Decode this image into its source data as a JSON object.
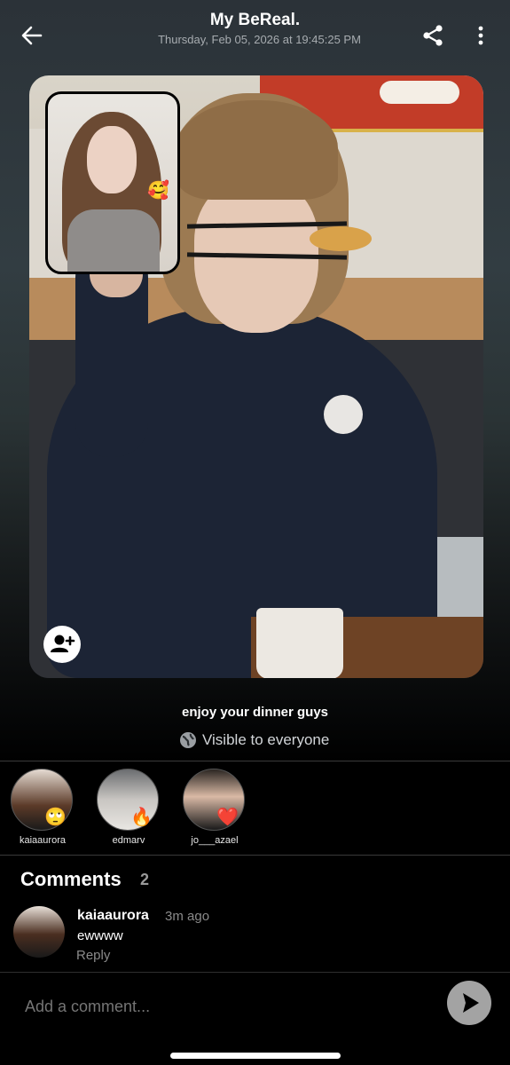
{
  "header": {
    "title": "My BeReal.",
    "timestamp": "Thursday, Feb 05, 2026 at 19:45:25 PM",
    "back_icon": "arrow-left-icon",
    "share_icon": "share-icon",
    "more_icon": "more-vertical-icon"
  },
  "post": {
    "inset_emoji": "🥰",
    "tag_icon": "add-person-icon",
    "caption": "enjoy your dinner guys",
    "visibility": "Visible to everyone",
    "visibility_icon": "globe-icon"
  },
  "reactions": [
    {
      "username": "kaiaaurora",
      "emoji": "🙄"
    },
    {
      "username": "edmarv",
      "emoji": "🔥"
    },
    {
      "username": "jo___azael",
      "emoji": "❤️"
    }
  ],
  "comments": {
    "title": "Comments",
    "count": "2",
    "items": [
      {
        "username": "kaiaaurora",
        "time": "3m ago",
        "text": "ewwww",
        "reply_label": "Reply"
      }
    ]
  },
  "composer": {
    "placeholder": "Add a comment...",
    "send_icon": "send-icon"
  }
}
